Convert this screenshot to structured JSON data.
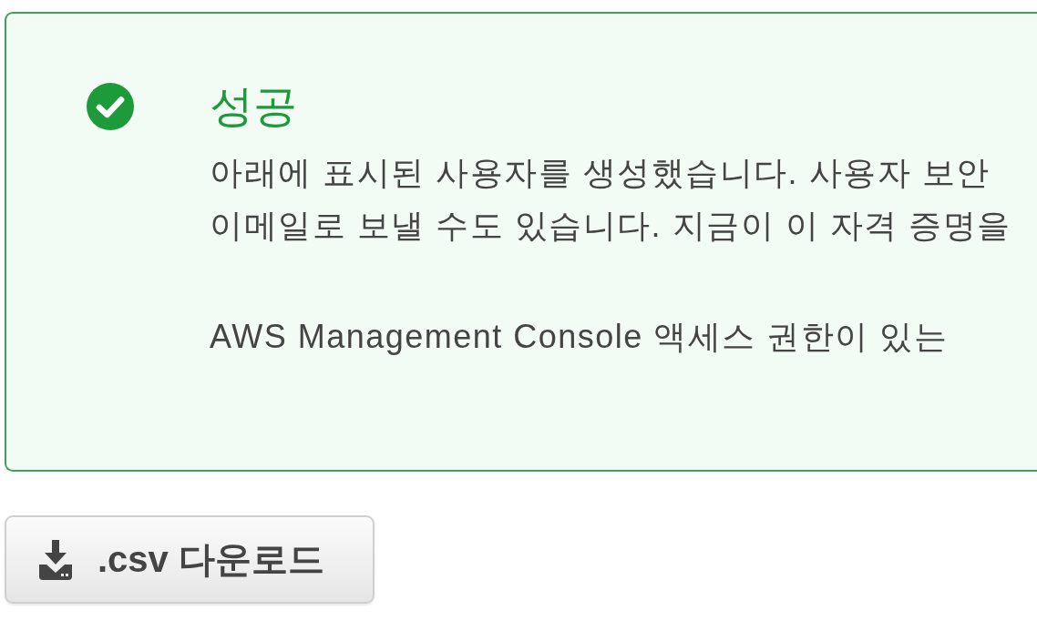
{
  "alert": {
    "kind": "success",
    "title": "성공",
    "paragraphs": [
      [
        "아래에 표시된 사용자를 생성했습니다. 사용자 보안",
        "이메일로 보낼 수도 있습니다. 지금이 이 자격 증명을"
      ],
      [
        "AWS Management Console 액세스 권한이 있는"
      ]
    ]
  },
  "buttons": [
    {
      "label": ".csv 다운로드"
    }
  ]
}
